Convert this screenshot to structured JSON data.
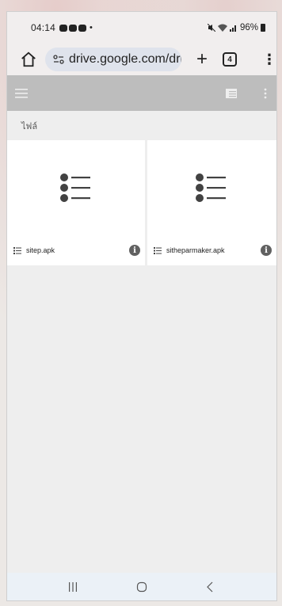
{
  "status_bar": {
    "time": "04:14",
    "battery": "96%"
  },
  "browser": {
    "url": "drive.google.com/drive",
    "tab_count": "4",
    "new_tab_label": "+",
    "menu_label": "⋮"
  },
  "drive": {
    "section_label": "ไฟล์",
    "files": [
      {
        "name": "sitep.apk",
        "icon": "list-file-icon"
      },
      {
        "name": "sitheparmaker.apk",
        "icon": "list-file-icon"
      }
    ]
  },
  "colors": {
    "toolbar": "#bdbdbd",
    "url_bg": "#dfe3ec",
    "info_icon": "#616161"
  }
}
